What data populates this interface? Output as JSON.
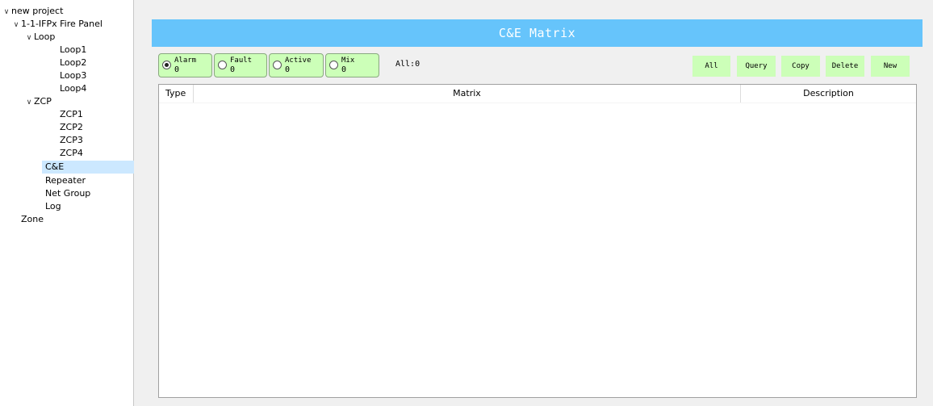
{
  "tree": {
    "root": "new project",
    "panel": "1-1-IFPx Fire Panel",
    "loop": "Loop",
    "loops": [
      "Loop1",
      "Loop2",
      "Loop3",
      "Loop4"
    ],
    "zcp": "ZCP",
    "zcps": [
      "ZCP1",
      "ZCP2",
      "ZCP3",
      "ZCP4"
    ],
    "ce": "C&E",
    "repeater": "Repeater",
    "net_group": "Net Group",
    "log": "Log",
    "zone": "Zone",
    "selected": "C&E"
  },
  "main": {
    "title": "C&E Matrix",
    "filters": [
      {
        "label": "Alarm",
        "count": "0",
        "selected": true
      },
      {
        "label": "Fault",
        "count": "0",
        "selected": false
      },
      {
        "label": "Active",
        "count": "0",
        "selected": false
      },
      {
        "label": "Mix",
        "count": "0",
        "selected": false
      }
    ],
    "all_count": "All:0",
    "toolbar": {
      "all": "All",
      "query": "Query",
      "copy": "Copy",
      "delete": "Delete",
      "new": "New"
    },
    "table": {
      "columns": [
        "Type",
        "Matrix",
        "Description"
      ],
      "rows": []
    }
  },
  "colors": {
    "banner": "#66c4fb",
    "button": "#ccffb8",
    "selection": "#cce8ff"
  },
  "icons": [
    "chevron-down-icon",
    "radio-icon"
  ]
}
